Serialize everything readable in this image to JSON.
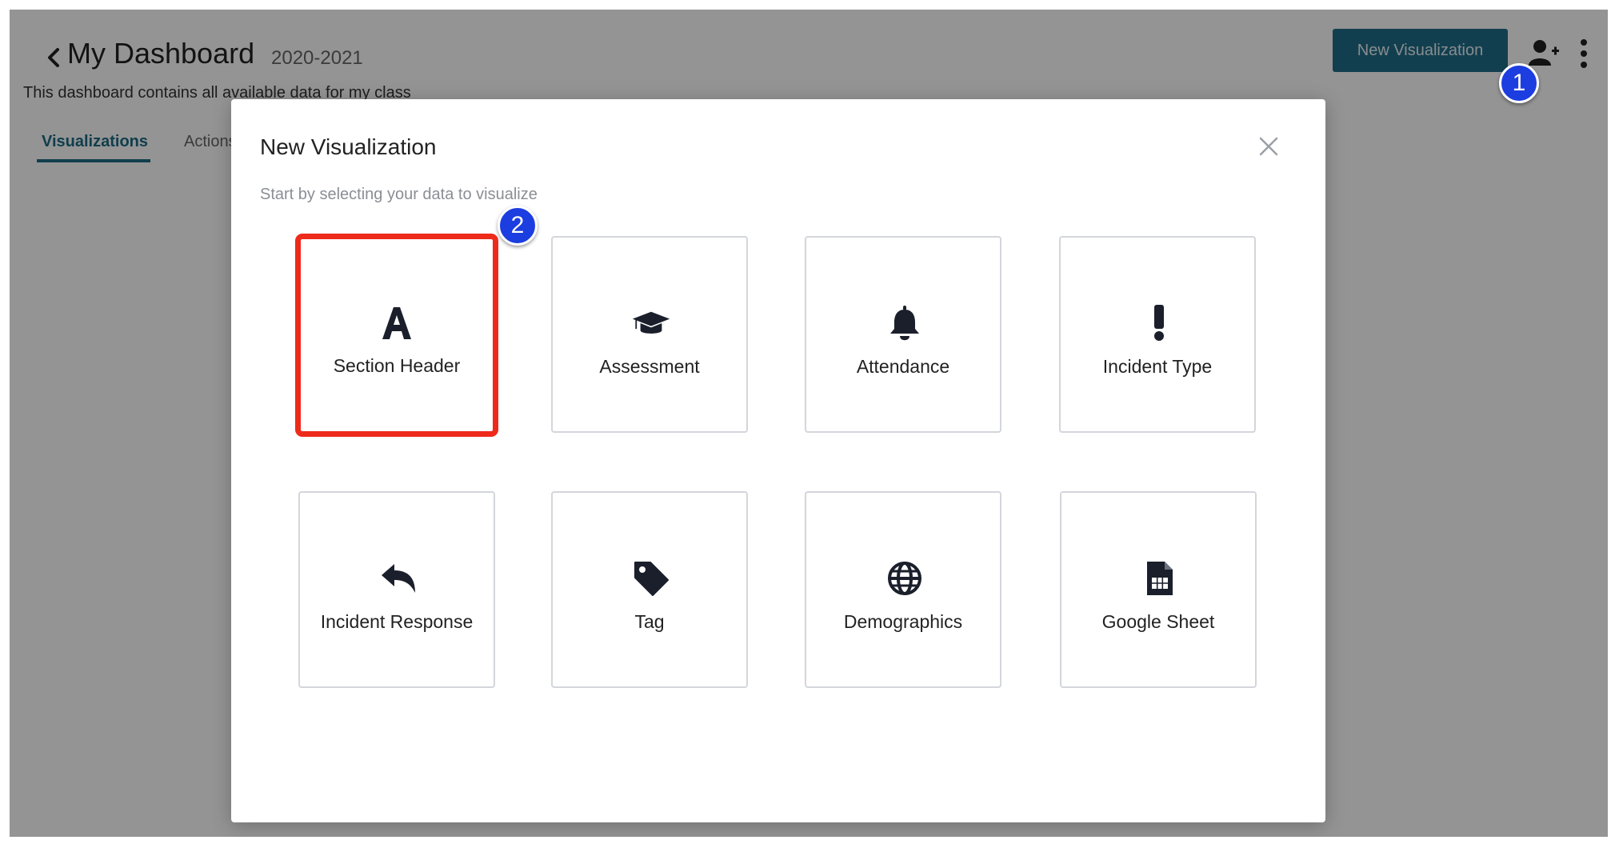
{
  "header": {
    "title": "My Dashboard",
    "year": "2020-2021",
    "description": "This dashboard contains all available data for my class",
    "new_visualization_label": "New Visualization"
  },
  "tabs": [
    {
      "label": "Visualizations",
      "active": true
    },
    {
      "label": "Actions",
      "active": false
    }
  ],
  "modal": {
    "title": "New Visualization",
    "subtitle": "Start by selecting your data to visualize",
    "options": [
      {
        "label": "Section Header",
        "icon": "letter-a-icon",
        "highlighted": true
      },
      {
        "label": "Assessment",
        "icon": "graduation-cap-icon"
      },
      {
        "label": "Attendance",
        "icon": "bell-icon"
      },
      {
        "label": "Incident Type",
        "icon": "exclamation-icon"
      },
      {
        "label": "Incident Response",
        "icon": "reply-arrow-icon"
      },
      {
        "label": "Tag",
        "icon": "tag-icon"
      },
      {
        "label": "Demographics",
        "icon": "globe-icon"
      },
      {
        "label": "Google Sheet",
        "icon": "spreadsheet-file-icon"
      }
    ]
  },
  "markers": {
    "step1": "1",
    "step2": "2"
  },
  "colors": {
    "primary": "#1f6d88",
    "highlight": "#ee2a1a",
    "marker": "#1c3de0"
  }
}
